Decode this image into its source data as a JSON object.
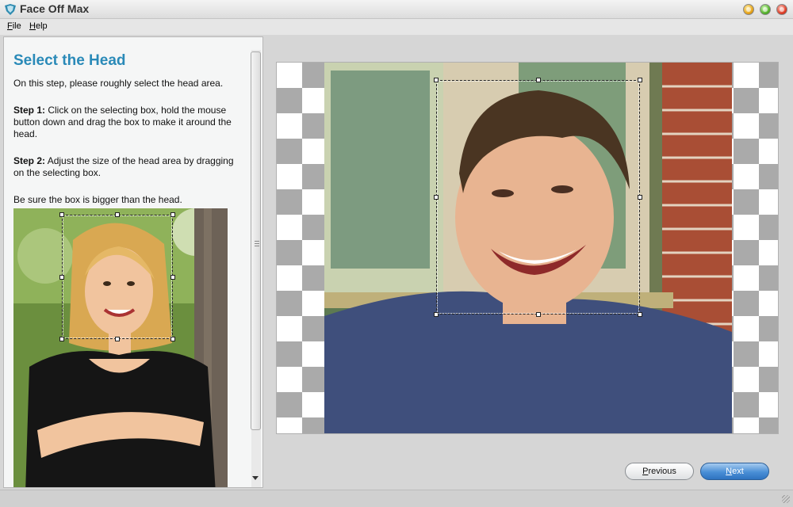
{
  "window": {
    "title": "Face Off Max",
    "icon": "face-off-logo-icon"
  },
  "menu": [
    {
      "label": "File",
      "underline": "F",
      "rest": "ile"
    },
    {
      "label": "Help",
      "underline": "H",
      "rest": "elp"
    }
  ],
  "instructions": {
    "heading": "Select the Head",
    "intro": "On this step, please roughly select the head area.",
    "step1_label": "Step 1:",
    "step1_text": " Click on the selecting box, hold the mouse button down and drag the box to make it around the head.",
    "step2_label": "Step 2:",
    "step2_text": " Adjust the size of the head area by dragging on the selecting box.",
    "note": "Be sure the box is bigger than the head."
  },
  "buttons": {
    "previous": {
      "label": "Previous",
      "underline": "P",
      "rest": "revious"
    },
    "next": {
      "label": "Next",
      "underline": "N",
      "rest": "ext"
    }
  },
  "colors": {
    "heading": "#2a8ab8",
    "next_button": "#4a8fd6"
  }
}
